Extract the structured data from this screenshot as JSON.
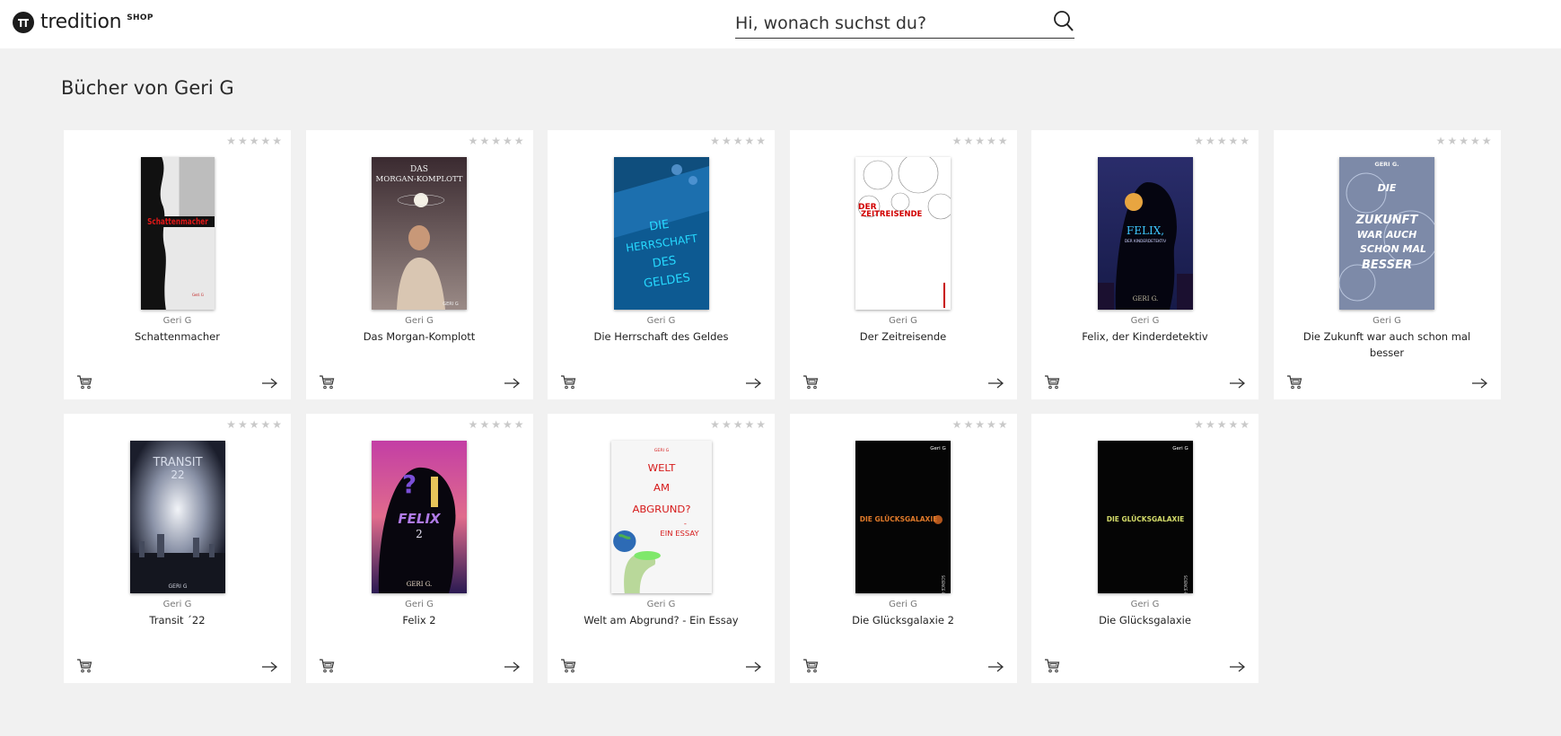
{
  "header": {
    "logo_text": "tredition",
    "logo_sup": "SHOP",
    "search_placeholder": "Hi, wonach suchst du?",
    "icons": {
      "logo": "tredition-logo-icon",
      "search": "search-icon"
    }
  },
  "page": {
    "title": "Bücher von Geri G"
  },
  "colors": {
    "background": "#f1f1f1",
    "card": "#ffffff",
    "star": "#c9c9c9"
  },
  "books": [
    {
      "author": "Geri G",
      "title": "Schattenmacher",
      "rating": 0,
      "cover": {
        "lines": [
          "Schattenmacher"
        ],
        "byline": "Geri G"
      }
    },
    {
      "author": "Geri G",
      "title": "Das Morgan-Komplott",
      "rating": 0,
      "cover": {
        "lines": [
          "DAS",
          "MORGAN-KOMPLOTT"
        ],
        "byline": "GERI G"
      }
    },
    {
      "author": "Geri G",
      "title": "Die Herrschaft des Geldes",
      "rating": 0,
      "cover": {
        "lines": [
          "DIE",
          "HERRSCHAFT",
          "DES",
          "GELDES"
        ],
        "byline": ""
      }
    },
    {
      "author": "Geri G",
      "title": "Der Zeitreisende",
      "rating": 0,
      "cover": {
        "lines": [
          "DER",
          "ZEITREISENDE"
        ],
        "byline": ""
      }
    },
    {
      "author": "Geri G",
      "title": "Felix, der Kinderdetektiv",
      "rating": 0,
      "cover": {
        "lines": [
          "FELIX,",
          "DER KINDERDETEKTIV"
        ],
        "byline": "GERI G."
      }
    },
    {
      "author": "Geri G",
      "title": "Die Zukunft war auch schon mal besser",
      "rating": 0,
      "cover": {
        "lines": [
          "DIE",
          "ZUKUNFT",
          "WAR AUCH",
          "SCHON MAL",
          "BESSER"
        ],
        "byline": "GERI G."
      }
    },
    {
      "author": "Geri G",
      "title": "Transit ´22",
      "rating": 0,
      "cover": {
        "lines": [
          "TRANSIT",
          "22"
        ],
        "byline": "GERI G"
      }
    },
    {
      "author": "Geri G",
      "title": "Felix 2",
      "rating": 0,
      "cover": {
        "lines": [
          "FELIX",
          "2"
        ],
        "byline": "GERI G."
      }
    },
    {
      "author": "Geri G",
      "title": "Welt am Abgrund? - Ein Essay",
      "rating": 0,
      "cover": {
        "lines": [
          "WELT",
          "AM",
          "ABGRUND?",
          "-",
          "EIN ESSAY"
        ],
        "byline": "GERI G"
      }
    },
    {
      "author": "Geri G",
      "title": "Die Glücksgalaxie 2",
      "rating": 0,
      "cover": {
        "lines": [
          "DIE GLÜCKSGALAXIE"
        ],
        "byline": "Geri G"
      }
    },
    {
      "author": "Geri G",
      "title": "Die Glücksgalaxie",
      "rating": 0,
      "cover": {
        "lines": [
          "DIE GLÜCKSGALAXIE"
        ],
        "byline": "Geri G"
      }
    }
  ]
}
